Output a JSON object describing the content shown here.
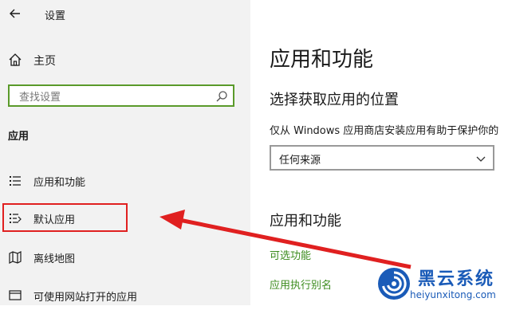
{
  "window": {
    "title": "设置"
  },
  "sidebar": {
    "home_label": "主页",
    "search_placeholder": "查找设置",
    "section_title": "应用",
    "items": [
      {
        "label": "应用和功能",
        "icon": "apps-features-icon"
      },
      {
        "label": "默认应用",
        "icon": "default-apps-icon"
      },
      {
        "label": "离线地图",
        "icon": "offline-maps-icon"
      },
      {
        "label": "可使用网站打开的应用",
        "icon": "apps-for-websites-icon"
      }
    ]
  },
  "main": {
    "title": "应用和功能",
    "subtitle": "选择获取应用的位置",
    "description": "仅从 Windows 应用商店安装应用有助于保护你的",
    "dropdown_value": "任何来源",
    "section_title": "应用和功能",
    "links": [
      "可选功能",
      "应用执行别名"
    ]
  },
  "watermark": {
    "title": "黑云系统",
    "url": "heiyunxitong.com"
  },
  "colors": {
    "sidebar_bg": "#f2f2f2",
    "search_border": "#5a9a2a",
    "link": "#3c8c1e",
    "annotation": "#e02020",
    "watermark": "#1a5bb8"
  }
}
